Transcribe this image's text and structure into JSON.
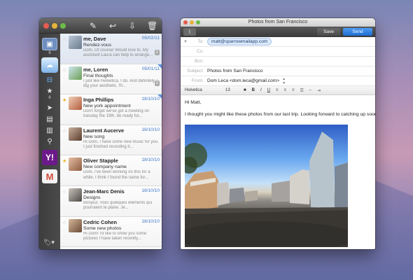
{
  "inbox": {
    "toolbar": [
      "compose-icon",
      "reply-icon",
      "archive-icon",
      "trash-icon"
    ],
    "sidebar": {
      "account_count": "6",
      "starred_count": "6",
      "yahoo_label": "Y!",
      "gmail_label": "M"
    },
    "messages": [
      {
        "from": "me, Dave",
        "date": "05/02/11",
        "subject": "Rendez-vous",
        "preview": "Dom, Of course! Would love to. My assistant Laura can help to arrange...",
        "count": "2",
        "starred": false
      },
      {
        "from": "me, Loren",
        "date": "05/01/11",
        "subject": "Final thoughts",
        "preview": "I just like Helvetica, I do. And definitely, I dig your aesthetic, I'll...",
        "count": "2",
        "starred": false
      },
      {
        "from": "Inga Phillips",
        "date": "18/10/10",
        "subject": "New york appointment",
        "preview": "Don't forget we've got a meeting on tuesday the 19th, be ready for...",
        "count": "",
        "starred": true
      },
      {
        "from": "Laurent Aucerve",
        "date": "18/10/10",
        "subject": "New song",
        "preview": "Hi Dom, I have some new music for you. I just finished recording it...",
        "count": "",
        "starred": false
      },
      {
        "from": "Oliver Stapple",
        "date": "18/10/10",
        "subject": "New company name",
        "preview": "Dom, I've been working on this for a while. I think I found the name for...",
        "count": "",
        "starred": true
      },
      {
        "from": "Jean-Marc Denis",
        "date": "18/10/10",
        "subject": "Designs",
        "preview": "Bonjour, Voici quelques éléments qui pourraient te plaire. Je...",
        "count": "",
        "starred": false
      },
      {
        "from": "Cedric Cohen",
        "date": "18/10/10",
        "subject": "Some new photos",
        "preview": "Hi Dom! I'd like to show you some pictures I have taken recently...",
        "count": "",
        "starred": false
      }
    ]
  },
  "compose": {
    "window_title": "Photos from San Francisco",
    "save_label": "Save",
    "send_label": "Send",
    "to_label": "To:",
    "to_value": "matt@sparrowmailapp.com",
    "cc_label": "Cc:",
    "bcc_label": "Bcc:",
    "subject_label": "Subject:",
    "subject_value": "Photos from San Francisco",
    "from_label": "From:",
    "from_value": "Dom Leca <dom.leca@gmail.com>",
    "format": {
      "font": "Helvetica",
      "size": "13",
      "bold": "B",
      "italic": "I",
      "underline": "U"
    },
    "greeting": "Hi Matt,",
    "body": "I thought you might like these photos from our last trip. Looking forward to catching up soon!",
    "attachment": "street-photo"
  }
}
